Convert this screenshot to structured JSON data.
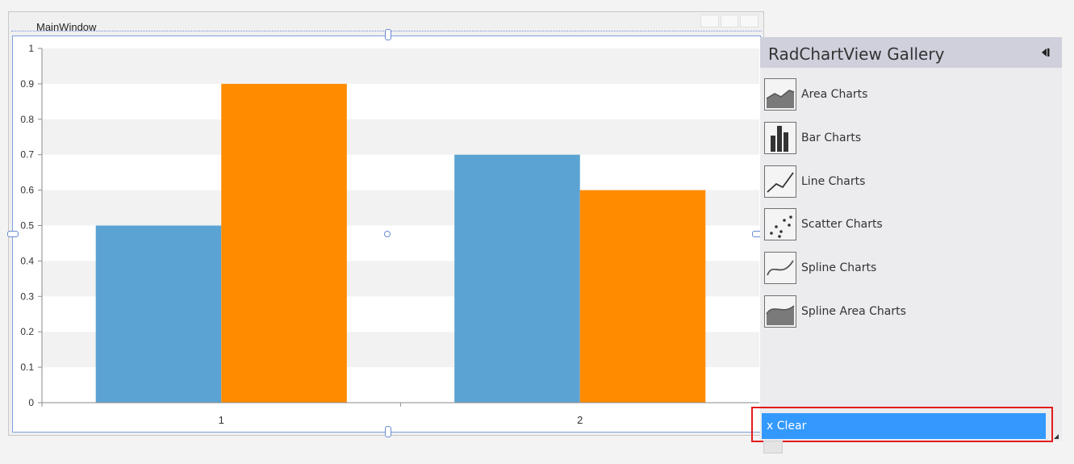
{
  "window": {
    "title": "MainWindow"
  },
  "chart_data": {
    "type": "bar",
    "categories": [
      "1",
      "2"
    ],
    "series": [
      {
        "values": [
          0.5,
          0.7
        ],
        "color": "#5ba3d3"
      },
      {
        "values": [
          0.9,
          0.6
        ],
        "color": "#ff8c00"
      }
    ],
    "ylim": [
      0,
      1
    ],
    "yticks": [
      "0",
      "0.1",
      "0.2",
      "0.3",
      "0.4",
      "0.5",
      "0.6",
      "0.7",
      "0.8",
      "0.9",
      "1"
    ],
    "grid": "alternating horizontal bands",
    "title": "",
    "xlabel": "",
    "ylabel": ""
  },
  "gallery": {
    "title": "RadChartView Gallery",
    "collapse_icon": "collapse-left-icon",
    "items": [
      {
        "label": "Area Charts",
        "icon": "area-chart-icon"
      },
      {
        "label": "Bar Charts",
        "icon": "bar-chart-icon"
      },
      {
        "label": "Line Charts",
        "icon": "line-chart-icon"
      },
      {
        "label": "Scatter Charts",
        "icon": "scatter-chart-icon"
      },
      {
        "label": "Spline Charts",
        "icon": "spline-chart-icon"
      },
      {
        "label": "Spline Area Charts",
        "icon": "spline-area-chart-icon"
      }
    ],
    "clear_label": "x Clear"
  },
  "colors": {
    "accent": "#3399ff",
    "highlight_outline": "#e21c1c"
  }
}
